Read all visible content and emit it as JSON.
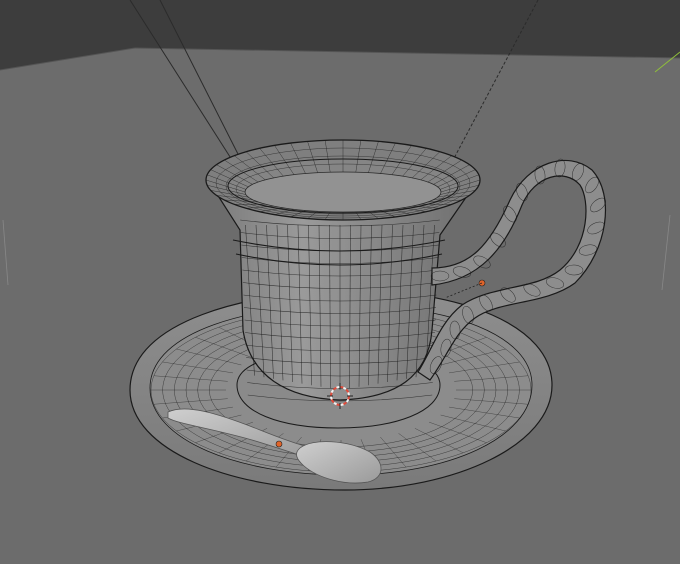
{
  "viewport": {
    "background_color": "#3d3d3d",
    "floor_color": "#6c6c6c",
    "mesh_fill_color": "#8a8a8a",
    "wire_color": "#1a1a1a",
    "origin_color": "#e0642a",
    "cursor_colors": [
      "#e04a3a",
      "#f2f2f2"
    ]
  },
  "scene": {
    "objects": [
      {
        "name": "cup",
        "icon": "cup-wireframe"
      },
      {
        "name": "handle",
        "icon": "handle-wireframe"
      },
      {
        "name": "saucer",
        "icon": "saucer-wireframe"
      },
      {
        "name": "spoon",
        "icon": "spoon-mesh"
      }
    ],
    "has_3d_cursor": true,
    "object_origins": 2,
    "light_lines": 3
  }
}
